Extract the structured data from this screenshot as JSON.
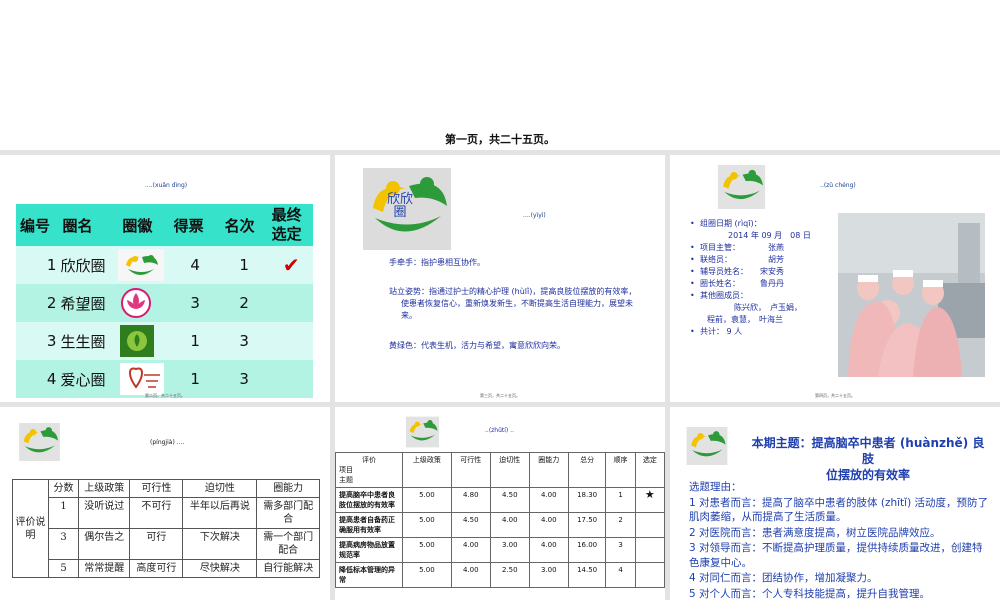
{
  "page": {
    "caption": "第一页，共二十五页。"
  },
  "slide1": {
    "title": "....(xuǎn dìng)",
    "headers": [
      "编号",
      "圈名",
      "圈徽",
      "得票",
      "名次",
      "最终选定"
    ],
    "rows": [
      {
        "no": "1",
        "name": "欣欣圈",
        "votes": "4",
        "rank": "1",
        "mark": "✔"
      },
      {
        "no": "2",
        "name": "希望圈",
        "votes": "3",
        "rank": "2",
        "mark": ""
      },
      {
        "no": "3",
        "name": "生生圈",
        "votes": "1",
        "rank": "3",
        "mark": ""
      },
      {
        "no": "4",
        "name": "爱心圈",
        "votes": "1",
        "rank": "3",
        "mark": ""
      }
    ],
    "footer": "第二页，共二十五页。"
  },
  "slide2": {
    "logo_text": "欣欣",
    "logo_text2": "圈",
    "title": "....(yìyì)",
    "lines": [
      "手牵手：指护患相互协作。",
      "站立姿势：指通过护士的精心护理 (hùlǐ)，提高良肢位摆放的有效率，使患者恢复信心，重新焕发新生，不断提高生活自理能力，展望未来。",
      "黄绿色：代表生机，活力与希望，寓意欣欣向荣。"
    ],
    "footer": "第三页，共二十五页。"
  },
  "slide3": {
    "title": "..(zǔ chéng)",
    "items": [
      "组圈日期 (rìqī)：",
      "项目主管：　　　　张燕",
      "联络员：　　　　　胡芳",
      "辅导员姓名：　　宋安秀",
      "圈长姓名：　　　鲁丹丹",
      "其他圈成员："
    ],
    "date_line": "2014 年 09 月　08 日",
    "members1": "陈兴欣，　卢玉娟，",
    "members2": "程前，袁慧，　叶海兰",
    "total": "共计：  9 人",
    "footer": "第四页，共二十五页。"
  },
  "slide4": {
    "title": "(píngjià) ....",
    "headers": [
      "分数",
      "上级政策",
      "可行性",
      "迫切性",
      "圈能力"
    ],
    "side_label": "评价说明",
    "rows": [
      [
        "1",
        "没听说过",
        "不可行",
        "半年以后再说",
        "需多部门配合"
      ],
      [
        "3",
        "偶尔告之",
        "可行",
        "下次解决",
        "需一个部门配合"
      ],
      [
        "5",
        "常常提醒",
        "高度可行",
        "尽快解决",
        "自行能解决"
      ]
    ]
  },
  "slide5": {
    "title": "..(zhǔtí) ..",
    "corner_top": "评价",
    "corner_mid": "项目",
    "corner_bottom": "主题",
    "headers": [
      "上级政策",
      "可行性",
      "迫切性",
      "圈能力",
      "总分",
      "顺序",
      "选定"
    ],
    "rows": [
      [
        "提高脑卒中患者良肢位摆放的有效率",
        "5.00",
        "4.80",
        "4.50",
        "4.00",
        "18.30",
        "1",
        "★"
      ],
      [
        "提高患者自备药正确服用有效率",
        "5.00",
        "4.50",
        "4.00",
        "4.00",
        "17.50",
        "2",
        ""
      ],
      [
        "提高病房物品放置规范率",
        "5.00",
        "4.00",
        "3.00",
        "4.00",
        "16.00",
        "3",
        ""
      ],
      [
        "降低标本管理的异常",
        "5.00",
        "4.00",
        "2.50",
        "3.00",
        "14.50",
        "4",
        ""
      ]
    ]
  },
  "slide6": {
    "title_line1": "本期主题：提高脑卒中患者 (huànzhě) 良肢",
    "title_line2": "位摆放的有效率",
    "reasons_label": "选题理由：",
    "reasons": [
      "1 对患者而言：提高了脑卒中患者的肢体 (zhītǐ) 活动度，预防了肌肉萎缩，从而提高了生活质量。",
      "2 对医院而言：患者满意度提高，树立医院品牌效应。",
      "3 对领导而言：不断提高护理质量，提供持续质量改进，创建特色康复中心。",
      "4 对同仁而言：团结协作，增加凝聚力。",
      "5 对个人而言：个人专科技能提高，提升自我管理。"
    ]
  },
  "colors": {
    "table_header": "#36e2c9",
    "row_light": "#d9f9f4",
    "row_mid": "#b2f3e4",
    "text_blue": "#1f3fae",
    "check_red": "#d00000"
  },
  "icons": [
    "team-logo-icon",
    "checkmark-icon",
    "star-icon",
    "lotus-emblem-icon",
    "heart-emblem-icon"
  ]
}
